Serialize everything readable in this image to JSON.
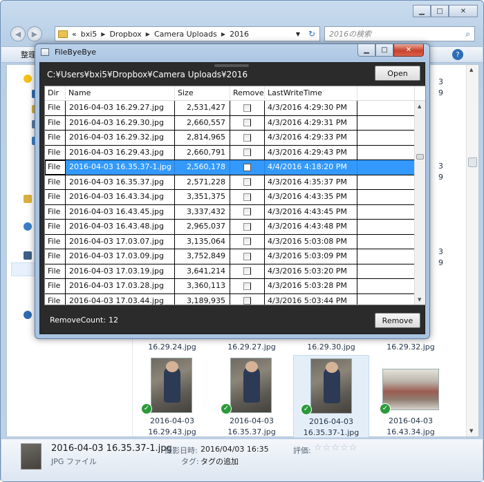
{
  "explorer": {
    "caption": {
      "minimize": "▁",
      "maximize": "□",
      "close": "✕"
    },
    "nav": {
      "back": "◀",
      "forward": "▶"
    },
    "address": {
      "prefix": "«",
      "crumbs": [
        "bxi5",
        "Dropbox",
        "Camera Uploads",
        "2016"
      ],
      "separator": "▶",
      "dropdown": "▼",
      "refresh": "↻"
    },
    "search": {
      "placeholder": "2016の検索",
      "icon": "search-icon"
    },
    "toolbar": {
      "organize": "整理 ▼",
      "help": "?"
    },
    "peek_labels": [
      "3",
      "9",
      "3",
      "9",
      "3",
      "9"
    ],
    "thumb_labels_top": [
      "16.29.24.jpg",
      "16.29.27.jpg",
      "16.29.30.jpg",
      "16.29.32.jpg"
    ],
    "thumbs": [
      {
        "line1": "2016-04-03",
        "line2": "16.29.43.jpg",
        "selected": false
      },
      {
        "line1": "2016-04-03",
        "line2": "16.35.37.jpg",
        "selected": false
      },
      {
        "line1": "2016-04-03",
        "line2": "16.35.37-1.jpg",
        "selected": true
      },
      {
        "line1": "2016-04-03",
        "line2": "16.43.34.jpg",
        "selected": false
      }
    ],
    "details": {
      "name": "2016-04-03 16.35.37-1.jpg",
      "type": "JPG ファイル",
      "shot_label": "撮影日時:",
      "shot_value": "2016/04/03 16:35",
      "rating_label": "評価:",
      "stars": "☆☆☆☆☆",
      "tags_label": "タグ:",
      "tags_value": "タグの追加"
    }
  },
  "app": {
    "title": "FileByeBye",
    "caption": {
      "minimize": "▁",
      "maximize": "□",
      "close": "✕"
    },
    "path": "C:¥Users¥bxi5¥Dropbox¥Camera Uploads¥2016",
    "open_label": "Open",
    "remove_label": "Remove",
    "remove_count_label": "RemoveCount:",
    "remove_count_value": "12",
    "columns": {
      "dir": "Dir",
      "name": "Name",
      "size": "Size",
      "remove": "Remove",
      "time": "LastWriteTime"
    },
    "scroll": {
      "up": "▲",
      "down": "▼"
    },
    "rows": [
      {
        "dir": "File",
        "name": "2016-04-03 16.29.27.jpg",
        "size": "2,531,427",
        "remove": false,
        "time": "4/3/2016 4:29:30 PM"
      },
      {
        "dir": "File",
        "name": "2016-04-03 16.29.30.jpg",
        "size": "2,660,557",
        "remove": false,
        "time": "4/3/2016 4:29:31 PM"
      },
      {
        "dir": "File",
        "name": "2016-04-03 16.29.32.jpg",
        "size": "2,814,965",
        "remove": false,
        "time": "4/3/2016 4:29:33 PM"
      },
      {
        "dir": "File",
        "name": "2016-04-03 16.29.43.jpg",
        "size": "2,660,791",
        "remove": false,
        "time": "4/3/2016 4:29:43 PM"
      },
      {
        "dir": "File",
        "name": "2016-04-03 16.35.37-1.jpg",
        "size": "2,560,178",
        "remove": true,
        "time": "4/4/2016 4:18:20 PM",
        "selected": true
      },
      {
        "dir": "File",
        "name": "2016-04-03 16.35.37.jpg",
        "size": "2,571,228",
        "remove": false,
        "time": "4/3/2016 4:35:37 PM"
      },
      {
        "dir": "File",
        "name": "2016-04-03 16.43.34.jpg",
        "size": "3,351,375",
        "remove": false,
        "time": "4/3/2016 4:43:35 PM"
      },
      {
        "dir": "File",
        "name": "2016-04-03 16.43.45.jpg",
        "size": "3,337,432",
        "remove": false,
        "time": "4/3/2016 4:43:45 PM"
      },
      {
        "dir": "File",
        "name": "2016-04-03 16.43.48.jpg",
        "size": "2,965,037",
        "remove": false,
        "time": "4/3/2016 4:43:48 PM"
      },
      {
        "dir": "File",
        "name": "2016-04-03 17.03.07.jpg",
        "size": "3,135,064",
        "remove": false,
        "time": "4/3/2016 5:03:08 PM"
      },
      {
        "dir": "File",
        "name": "2016-04-03 17.03.09.jpg",
        "size": "3,752,849",
        "remove": false,
        "time": "4/3/2016 5:03:09 PM"
      },
      {
        "dir": "File",
        "name": "2016-04-03 17.03.19.jpg",
        "size": "3,641,214",
        "remove": false,
        "time": "4/3/2016 5:03:20 PM"
      },
      {
        "dir": "File",
        "name": "2016-04-03 17.03.28.jpg",
        "size": "3,360,113",
        "remove": false,
        "time": "4/3/2016 5:03:28 PM"
      },
      {
        "dir": "File",
        "name": "2016-04-03 17.03.44.jpg",
        "size": "3,189,935",
        "remove": false,
        "time": "4/3/2016 5:03:44 PM"
      }
    ]
  },
  "colors": {
    "selection": "#3399ff",
    "app_background": "#2b2b2b",
    "close_button": "#c8412b",
    "check_badge": "#2b9a3b"
  }
}
